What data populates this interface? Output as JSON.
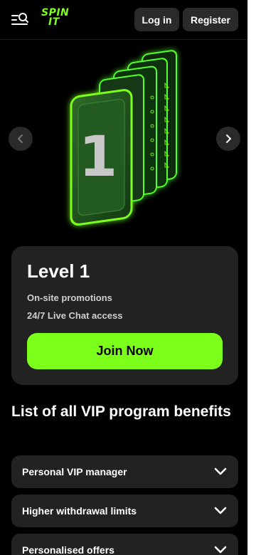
{
  "header": {
    "logo_line1": "SPIN",
    "logo_line2": "IT",
    "login_label": "Log in",
    "register_label": "Register"
  },
  "hero": {
    "card_number": "1"
  },
  "level": {
    "title": "Level 1",
    "perks": [
      "On-site promotions",
      "24/7 Live Chat access"
    ],
    "join_label": "Join Now"
  },
  "benefits": {
    "title": "List of all VIP program benefits",
    "items": [
      {
        "label": "Personal VIP manager"
      },
      {
        "label": "Higher withdrawal limits"
      },
      {
        "label": "Personalised offers"
      }
    ]
  },
  "colors": {
    "accent": "#7dff1c",
    "card_bg": "#222222",
    "button_bg": "#2a2a2a"
  }
}
